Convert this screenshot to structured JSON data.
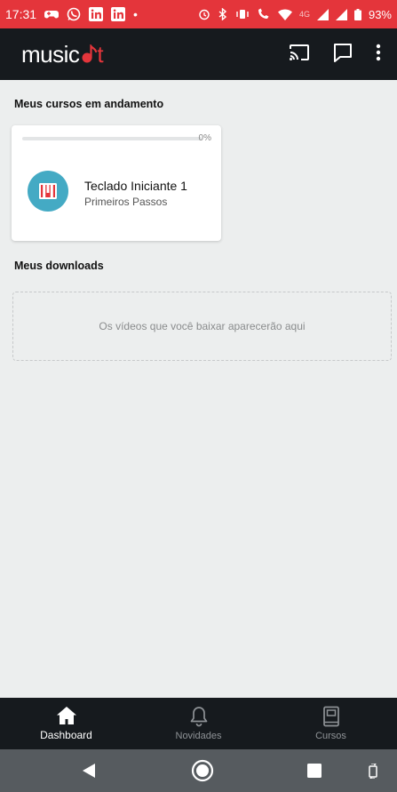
{
  "status_bar": {
    "time": "17:31",
    "dot": "•",
    "net_label": "4G",
    "lte_label": "4G",
    "battery": "93%"
  },
  "app_bar": {
    "logo_prefix": "music",
    "logo_suffix": "t",
    "actions": [
      "cast-icon",
      "chat-icon",
      "more-vert-icon"
    ]
  },
  "courses_section": {
    "title": "Meus cursos em andamento",
    "courses": [
      {
        "progress": 0,
        "progress_label": "0%",
        "title": "Teclado Iniciante 1",
        "subtitle": "Primeiros Passos",
        "icon": "piano-icon",
        "icon_bg": "#44aac4"
      }
    ]
  },
  "downloads_section": {
    "title": "Meus downloads",
    "empty_message": "Os vídeos que você baixar aparecerão aqui"
  },
  "bottom_nav": {
    "items": [
      {
        "label": "Dashboard",
        "icon": "home-icon",
        "active": true
      },
      {
        "label": "Novidades",
        "icon": "bell-icon",
        "active": false
      },
      {
        "label": "Cursos",
        "icon": "book-icon",
        "active": false
      }
    ]
  },
  "colors": {
    "brand": "#e4353b",
    "app_bar": "#161a1e",
    "background": "#eceeee"
  }
}
